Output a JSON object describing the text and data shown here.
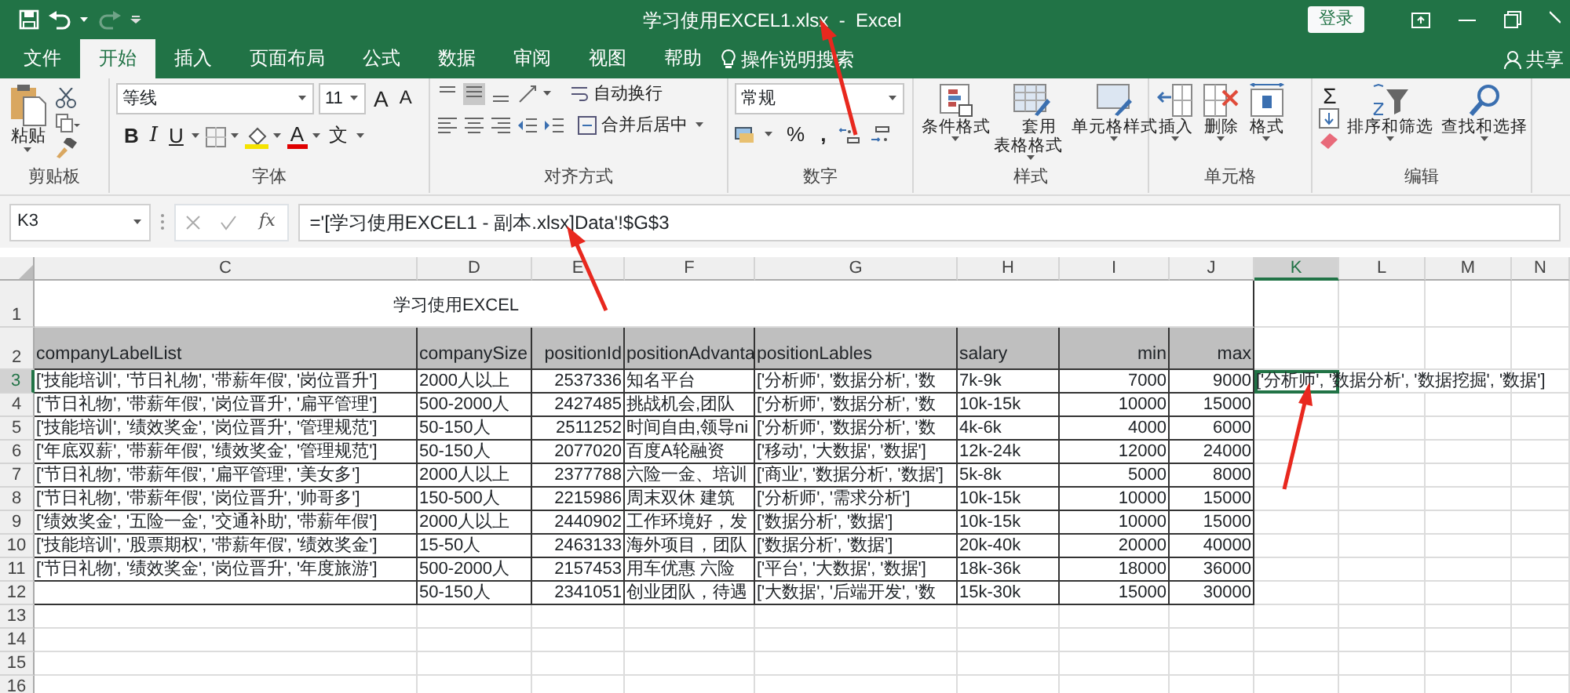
{
  "window": {
    "title": "学习使用EXCEL1.xlsx  -  Excel",
    "login": "登录"
  },
  "tabs": [
    {
      "label": "文件",
      "selected": false
    },
    {
      "label": "开始",
      "selected": true
    },
    {
      "label": "插入",
      "selected": false
    },
    {
      "label": "页面布局",
      "selected": false
    },
    {
      "label": "公式",
      "selected": false
    },
    {
      "label": "数据",
      "selected": false
    },
    {
      "label": "审阅",
      "selected": false
    },
    {
      "label": "视图",
      "selected": false
    },
    {
      "label": "帮助",
      "selected": false
    }
  ],
  "tell_me": "操作说明搜索",
  "share": "共享",
  "ribbon": {
    "clipboard": {
      "label": "剪贴板",
      "paste": "粘贴"
    },
    "font": {
      "label": "字体",
      "font_name": "等线",
      "font_size": "11",
      "bold": "B",
      "italic": "I",
      "underline": "U",
      "grow": "A",
      "shrink": "A",
      "font_color": "A",
      "phonetic": "文"
    },
    "alignment": {
      "label": "对齐方式",
      "wrap": "自动换行",
      "merge": "合并后居中"
    },
    "number": {
      "label": "数字",
      "format": "常规",
      "percent": "%",
      "comma": ","
    },
    "styles": {
      "label": "样式",
      "buttons": [
        "条件格式",
        "套用表格格式",
        "单元格样式"
      ]
    },
    "cells": {
      "label": "单元格",
      "buttons": [
        "插入",
        "删除",
        "格式"
      ]
    },
    "editing": {
      "label": "编辑",
      "sum": "Σ",
      "buttons": [
        "排序和筛选",
        "查找和选择"
      ]
    }
  },
  "formula_bar": {
    "name_box": "K3",
    "fx": "fx",
    "formula": "='[学习使用EXCEL1 - 副本.xlsx]Data'!$G$3"
  },
  "column_headers": [
    {
      "label": "C",
      "selected": false
    },
    {
      "label": "D",
      "selected": false
    },
    {
      "label": "E",
      "selected": false
    },
    {
      "label": "F",
      "selected": false
    },
    {
      "label": "G",
      "selected": false
    },
    {
      "label": "H",
      "selected": false
    },
    {
      "label": "I",
      "selected": false
    },
    {
      "label": "J",
      "selected": false
    },
    {
      "label": "K",
      "selected": true
    },
    {
      "label": "L",
      "selected": false
    },
    {
      "label": "M",
      "selected": false
    },
    {
      "label": "N",
      "selected": false
    }
  ],
  "row_headers": [
    {
      "label": "1",
      "selected": false
    },
    {
      "label": "2",
      "selected": false
    },
    {
      "label": "3",
      "selected": true
    },
    {
      "label": "4",
      "selected": false
    },
    {
      "label": "5",
      "selected": false
    },
    {
      "label": "6",
      "selected": false
    },
    {
      "label": "7",
      "selected": false
    },
    {
      "label": "8",
      "selected": false
    },
    {
      "label": "9",
      "selected": false
    },
    {
      "label": "10",
      "selected": false
    },
    {
      "label": "11",
      "selected": false
    },
    {
      "label": "12",
      "selected": false
    },
    {
      "label": "13",
      "selected": false
    },
    {
      "label": "14",
      "selected": false
    },
    {
      "label": "15",
      "selected": false
    },
    {
      "label": "16",
      "selected": false
    }
  ],
  "sheet_title": "学习使用EXCEL",
  "table": {
    "columns": [
      {
        "label": "companyLabelList",
        "numeric": false
      },
      {
        "label": "companySize",
        "numeric": false
      },
      {
        "label": "positionId",
        "numeric": true
      },
      {
        "label": "positionAdvanta",
        "numeric": false
      },
      {
        "label": "positionLables",
        "numeric": false
      },
      {
        "label": "salary",
        "numeric": false
      },
      {
        "label": "min",
        "numeric": true
      },
      {
        "label": "max",
        "numeric": true
      }
    ],
    "rows": [
      [
        "['技能培训', '节日礼物', '带薪年假', '岗位晋升']",
        "2000人以上",
        "2537336",
        "知名平台",
        "['分析师', '数据分析', '数",
        "7k-9k",
        "7000",
        "9000"
      ],
      [
        "['节日礼物', '带薪年假', '岗位晋升', '扁平管理']",
        "500-2000人",
        "2427485",
        "挑战机会,团队",
        "['分析师', '数据分析', '数",
        "10k-15k",
        "10000",
        "15000"
      ],
      [
        "['技能培训', '绩效奖金', '岗位晋升', '管理规范']",
        "50-150人",
        "2511252",
        "时间自由,领导ni",
        "['分析师', '数据分析', '数",
        "4k-6k",
        "4000",
        "6000"
      ],
      [
        "['年底双薪', '带薪年假', '绩效奖金', '管理规范']",
        "50-150人",
        "2077020",
        "百度A轮融资",
        "['移动', '大数据', '数据']",
        "12k-24k",
        "12000",
        "24000"
      ],
      [
        "['节日礼物', '带薪年假', '扁平管理', '美女多']",
        "2000人以上",
        "2377788",
        "六险一金、培训",
        "['商业', '数据分析', '数据']",
        "5k-8k",
        "5000",
        "8000"
      ],
      [
        "['节日礼物', '带薪年假', '岗位晋升', '帅哥多']",
        "150-500人",
        "2215986",
        "周末双休 建筑",
        "['分析师', '需求分析']",
        "10k-15k",
        "10000",
        "15000"
      ],
      [
        "['绩效奖金', '五险一金', '交通补助', '带薪年假']",
        "2000人以上",
        "2440902",
        "工作环境好，发",
        "['数据分析', '数据']",
        "10k-15k",
        "10000",
        "15000"
      ],
      [
        "['技能培训', '股票期权', '带薪年假', '绩效奖金']",
        "15-50人",
        "2463133",
        "海外项目，团队",
        "['数据分析', '数据']",
        "20k-40k",
        "20000",
        "40000"
      ],
      [
        "['节日礼物', '绩效奖金', '岗位晋升', '年度旅游']",
        "500-2000人",
        "2157453",
        "用车优惠 六险",
        "['平台', '大数据', '数据']",
        "18k-36k",
        "18000",
        "36000"
      ],
      [
        null,
        "50-150人",
        "2341051",
        "创业团队，待遇",
        "['大数据', '后端开发', '数",
        "15k-30k",
        "15000",
        "30000"
      ]
    ]
  },
  "k3_value": "['分析师', '数据分析', '数据挖掘', '数据']"
}
